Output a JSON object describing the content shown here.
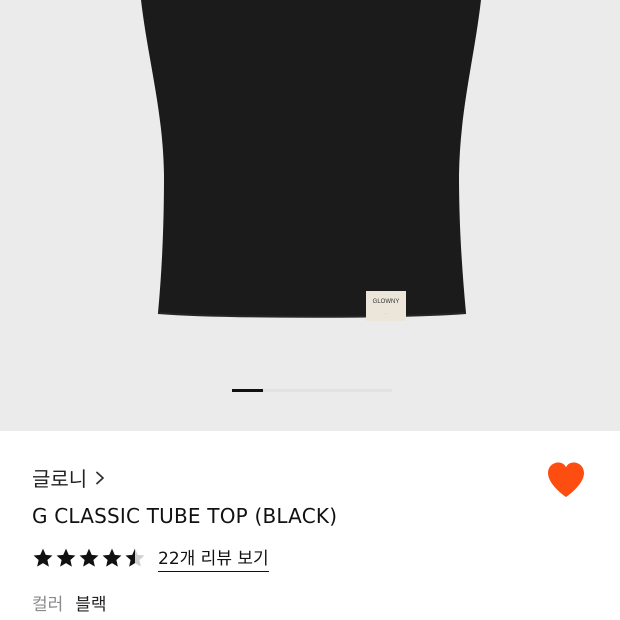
{
  "product": {
    "label_text": "GLOWNY",
    "brand": "글로니",
    "title": "G CLASSIC TUBE TOP (BLACK)",
    "rating": 4.5,
    "review_link": "22개 리뷰 보기",
    "color_label": "컬러",
    "color_value": "블랙",
    "wishlisted": true
  },
  "carousel": {
    "current": 1
  },
  "icons": {
    "brand_chevron": "chevron-right-icon",
    "wishlist": "heart-icon",
    "star": "star-icon"
  },
  "colors": {
    "accent": "#fd4d10",
    "hero_bg": "#ebebeb",
    "garment": "#1b1b1b"
  }
}
